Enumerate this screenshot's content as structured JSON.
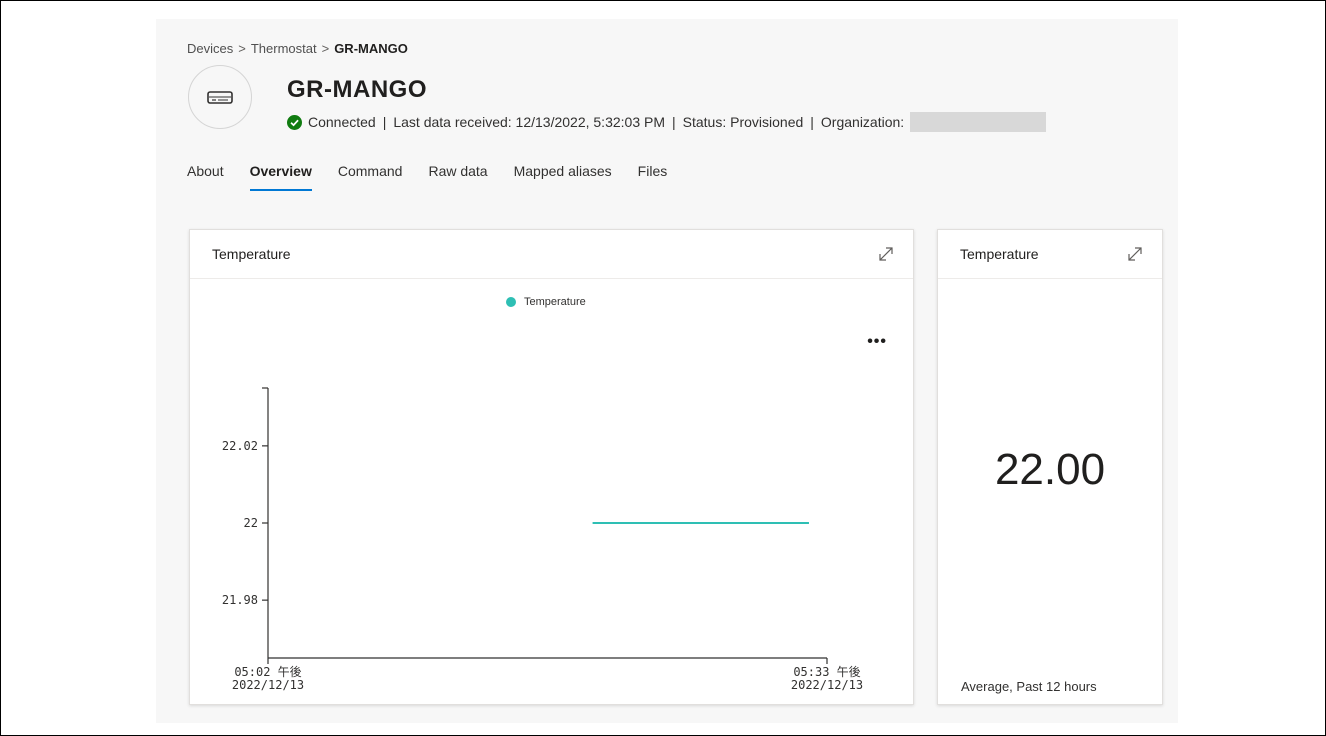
{
  "breadcrumb": {
    "items": [
      "Devices",
      "Thermostat",
      "GR-MANGO"
    ],
    "separator": ">"
  },
  "device": {
    "icon": "device-icon",
    "title": "GR-MANGO",
    "status_icon": "check-circle-icon",
    "connection": "Connected",
    "last_data": "Last data received: 12/13/2022, 5:32:03 PM",
    "status": "Status: Provisioned",
    "organization_label": "Organization:"
  },
  "tabs": [
    {
      "label": "About",
      "active": false
    },
    {
      "label": "Overview",
      "active": true
    },
    {
      "label": "Command",
      "active": false
    },
    {
      "label": "Raw data",
      "active": false
    },
    {
      "label": "Mapped aliases",
      "active": false
    },
    {
      "label": "Files",
      "active": false
    }
  ],
  "chart_card": {
    "title": "Temperature",
    "more_icon": "more-icon",
    "expand_icon": "expand-icon"
  },
  "kpi_card": {
    "title": "Temperature",
    "value": "22.00",
    "caption": "Average, Past 12 hours",
    "expand_icon": "expand-icon"
  },
  "colors": {
    "accent": "#0078d4",
    "series": "#2ebfb4",
    "connected": "#107c10"
  },
  "chart_data": {
    "type": "line",
    "title": "",
    "xlabel": "",
    "ylabel": "",
    "legend": "top-center",
    "series": [
      {
        "name": "Temperature",
        "x": [
          "2022-12-13 17:20",
          "2022-12-13 17:32"
        ],
        "values": [
          22,
          22
        ]
      }
    ],
    "x_ticks": [
      {
        "line1": "05:02 午後",
        "line2": "2022/12/13",
        "t": 0
      },
      {
        "line1": "05:33 午後",
        "line2": "2022/12/13",
        "t": 31
      }
    ],
    "y_ticks": [
      "22.02",
      "22",
      "21.98"
    ],
    "ylim": [
      21.965,
      22.035
    ],
    "xlim_minutes": [
      0,
      31
    ],
    "series_minutes": [
      18,
      30
    ],
    "grid": false
  }
}
